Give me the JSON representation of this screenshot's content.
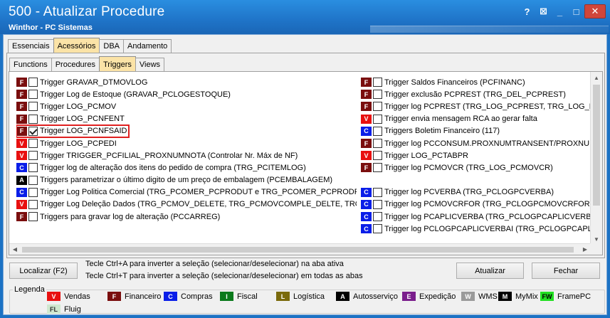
{
  "window": {
    "title": "500 - Atualizar Procedure",
    "subtitle": "Winthor - PC Sistemas",
    "controls": [
      "?",
      "⊠",
      "_",
      "□",
      "✕"
    ]
  },
  "top_tabs": [
    "Essenciais",
    "Acessórios",
    "DBA",
    "Andamento"
  ],
  "top_tab_active": "Acessórios",
  "inner_tabs": [
    "Functions",
    "Procedures",
    "Triggers",
    "Views"
  ],
  "inner_tab_active": "Triggers",
  "left_items": [
    {
      "badge": "F",
      "label": "Trigger GRAVAR_DTMOVLOG",
      "checked": false
    },
    {
      "badge": "F",
      "label": "Trigger Log de Estoque (GRAVAR_PCLOGESTOQUE)",
      "checked": false
    },
    {
      "badge": "F",
      "label": "Trigger LOG_PCMOV",
      "checked": false
    },
    {
      "badge": "F",
      "label": "Trigger LOG_PCNFENT",
      "checked": false
    },
    {
      "badge": "F",
      "label": "Trigger LOG_PCNFSAID",
      "checked": true
    },
    {
      "badge": "V",
      "label": "Trigger LOG_PCPEDI",
      "checked": false
    },
    {
      "badge": "V",
      "label": "Trigger TRIGGER_PCFILIAL_PROXNUMNOTA (Controlar Nr. Máx de NF)",
      "checked": false
    },
    {
      "badge": "C",
      "label": "Trigger log de alteração dos itens do pedido de compra (TRG_PCITEMLOG)",
      "checked": false
    },
    {
      "badge": "A",
      "label": "Triggers parametrizar o último digito de um preço de embalagem (PCEMBALAGEM)",
      "checked": false
    },
    {
      "badge": "C",
      "label": "Trigger Log Politica Comercial (TRG_PCOMER_PCPRODUT e TRG_PCOMER_PCPRODFILIAL)",
      "checked": false
    },
    {
      "badge": "V",
      "label": "Trigger Log Deleção Dados (TRG_PCMOV_DELETE, TRG_PCMOVCOMPLE_DELTE, TRG_PCNF",
      "checked": false
    },
    {
      "badge": "F",
      "label": "Triggers para gravar log de alteração (PCCARREG)",
      "checked": false
    }
  ],
  "right_items": [
    {
      "badge": "F",
      "label": "Trigger Saldos Financeiros (PCFINANC)",
      "checked": false
    },
    {
      "badge": "F",
      "label": "Trigger exclusão PCPREST (TRG_DEL_PCPREST)",
      "checked": false
    },
    {
      "badge": "F",
      "label": "Trigger log PCPREST (TRG_LOG_PCPREST, TRG_LOG_PCPRE",
      "checked": false
    },
    {
      "badge": "V",
      "label": "Trigger envia mensagem RCA ao gerar falta",
      "checked": false
    },
    {
      "badge": "C",
      "label": "Triggers Boletim Financeiro (117)",
      "checked": false
    },
    {
      "badge": "F",
      "label": "Trigger log  PCCONSUM.PROXNUMTRANSENT/PROXNUMTRAI",
      "checked": false
    },
    {
      "badge": "V",
      "label": "Trigger LOG_PCTABPR",
      "checked": false
    },
    {
      "badge": "F",
      "label": "Trigger log PCMOVCR (TRG_LOG_PCMOVCR)",
      "checked": false
    },
    {
      "badge": "",
      "label": "",
      "checked": false
    },
    {
      "badge": "C",
      "label": "Trigger log PCVERBA (TRG_PCLOGPCVERBA)",
      "checked": false
    },
    {
      "badge": "C",
      "label": "Trigger log PCMOVCRFOR  (TRG_PCLOGPCMOVCRFOR)",
      "checked": false
    },
    {
      "badge": "C",
      "label": "Trigger log PCAPLICVERBA (TRG_PCLOGPCAPLICVERBA)",
      "checked": false
    },
    {
      "badge": "C",
      "label": "Trigger log PCLOGPCAPLICVERBAI  (TRG_PCLOGPCAPLICVERBAI",
      "checked": false
    }
  ],
  "buttons": {
    "localizar": "Localizar (F2)",
    "atualizar": "Atualizar",
    "fechar": "Fechar"
  },
  "hints": [
    "Tecle Ctrl+A para inverter a seleção (selecionar/deselecionar) na aba ativa",
    "Tecle Ctrl+T para inverter a seleção (selecionar/deselecionar) em todas as abas"
  ],
  "legend": {
    "title": "Legenda",
    "items": [
      {
        "badge": "V",
        "label": "Vendas",
        "bg": "#e81010",
        "fg": "#ffffff"
      },
      {
        "badge": "F",
        "label": "Financeiro",
        "bg": "#7a0e0e",
        "fg": "#ffffff"
      },
      {
        "badge": "C",
        "label": "Compras",
        "bg": "#0a1ee8",
        "fg": "#ffffff"
      },
      {
        "badge": "I",
        "label": "Fiscal",
        "bg": "#0b7a1c",
        "fg": "#ffffff"
      },
      {
        "badge": "L",
        "label": "Logística",
        "bg": "#7a6a0c",
        "fg": "#ffffff"
      },
      {
        "badge": "A",
        "label": "Autosserviço",
        "bg": "#000000",
        "fg": "#ffffff"
      },
      {
        "badge": "E",
        "label": "Expedição",
        "bg": "#7a1e8c",
        "fg": "#ffffff"
      },
      {
        "badge": "W",
        "label": "WMS",
        "bg": "#9a9a9a",
        "fg": "#ffffff"
      },
      {
        "badge": "M",
        "label": "MyMix",
        "bg": "#000000",
        "fg": "#ffffff"
      },
      {
        "badge": "FW",
        "label": "FramePC",
        "bg": "#22e022",
        "fg": "#000000"
      },
      {
        "badge": "FL",
        "label": "Fluig",
        "bg": "#cfe8cf",
        "fg": "#333333"
      }
    ]
  },
  "badge_colors": {
    "F": "#7a0e0e",
    "V": "#e81010",
    "C": "#0a1ee8",
    "A": "#000000"
  }
}
